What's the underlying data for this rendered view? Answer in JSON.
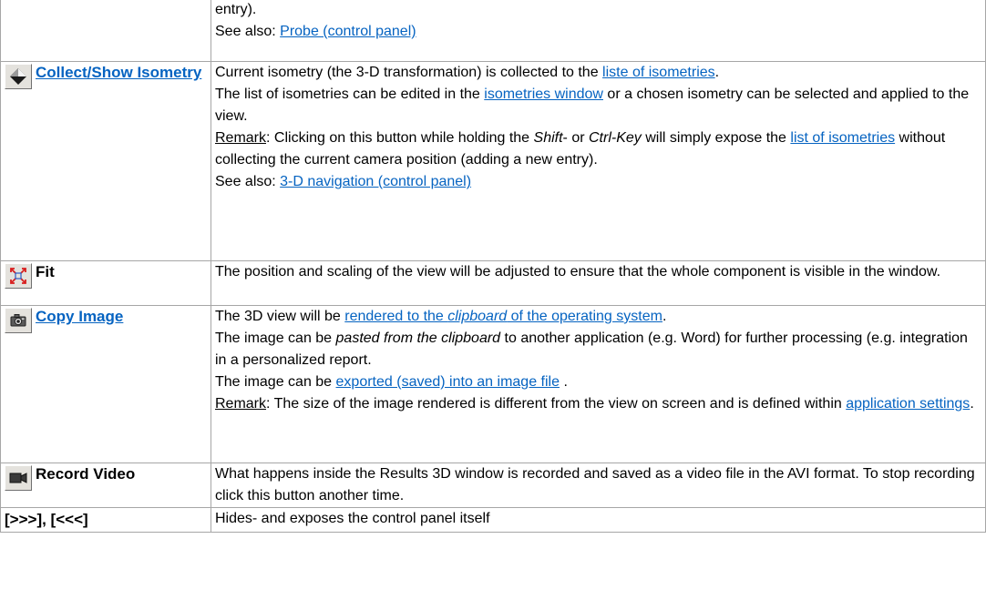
{
  "rows": [
    {
      "command": "",
      "lines": {
        "entry_end": "entry).",
        "see_also_prefix": "See also: ",
        "see_also_link": "Probe (control panel)"
      }
    },
    {
      "command": "Collect/Show Isometry",
      "icon": "isometry-diamond-icon",
      "lines": {
        "l1_pre": "Current isometry (the 3-D transformation) is collected to the ",
        "l1_link": "liste of isometries",
        "l1_post": ".",
        "l2_pre": "The list of isometries can be edited in the ",
        "l2_link": "isometries window",
        "l2_post": " or a chosen isometry can be selected and applied to the view.",
        "remark_label": "Remark",
        "remark_pre": ": Clicking on this button while holding the ",
        "remark_shift": "Shift",
        "remark_mid": "- or ",
        "remark_ctrl": "Ctrl-Key",
        "remark_mid2": " will simply expose the ",
        "remark_link": "list of isometries",
        "remark_post": " without collecting the current camera position (adding a new entry).",
        "see_also_prefix": "See also: ",
        "see_also_link": "3-D navigation (control panel)"
      }
    },
    {
      "command": "Fit",
      "icon": "fit-zoom-extents-icon",
      "text": "The position and scaling of the view will be adjusted to ensure that the whole component is visible in the window."
    },
    {
      "command": "Copy Image",
      "icon": "camera-icon",
      "lines": {
        "l1_pre": "The 3D view will be ",
        "l1_link_a": "rendered to the ",
        "l1_link_b": "clipboard",
        "l1_link_c": " of the operating system",
        "l1_post": ".",
        "l2_pre": "The image can be ",
        "l2_italic": "pasted from the clipboard",
        "l2_post": " to another application (e.g. Word) for further processing (e.g. integration in a personalized report.",
        "l3_pre": "The image can be ",
        "l3_link": "exported (saved) into an image file",
        "l3_post": " .",
        "remark_label": "Remark",
        "remark_pre": ": The size of the image rendered is different from the view on screen and is defined within ",
        "remark_link": "application settings",
        "remark_post": "."
      }
    },
    {
      "command": "Record Video",
      "icon": "video-camera-icon",
      "text": "What happens inside the Results 3D window is recorded and saved as a video file in the AVI format. To stop recording click this button another time."
    },
    {
      "command": "[>>>], [<<<]",
      "text": "Hides- and exposes the control panel itself"
    }
  ]
}
